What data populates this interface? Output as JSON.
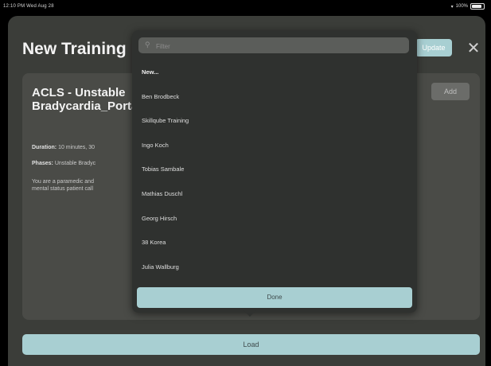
{
  "status_bar": {
    "time_date": "12:10 PM  Wed Aug 28",
    "battery": "100%",
    "battery_level": 1.0
  },
  "modal": {
    "title": "New Training",
    "update_label": "Update",
    "close_glyph": "✕"
  },
  "card": {
    "title": "ACLS - Unstable Bradycardia_Portal_38K",
    "duration_label": "Duration:",
    "duration_value": "10 minutes, 30",
    "phases_label": "Phases:",
    "phases_value": "Unstable Bradyc",
    "desc_line1": "You are a paramedic and",
    "desc_line2": "mental status patient call",
    "add_label": "Add"
  },
  "popover": {
    "filter_placeholder": "Filter",
    "search_icon": "search-icon",
    "items": [
      {
        "label": "New..."
      },
      {
        "label": "Ben Brodbeck"
      },
      {
        "label": "Skillqube Training"
      },
      {
        "label": "Ingo Koch"
      },
      {
        "label": "Tobias Sambale"
      },
      {
        "label": "Mathias Duschl"
      },
      {
        "label": "Georg Hirsch"
      },
      {
        "label": "38 Korea"
      },
      {
        "label": "Julia Wallburg"
      }
    ],
    "done_label": "Done"
  },
  "footer": {
    "load_label": "Load"
  },
  "colors": {
    "accent": "#a8cfd2",
    "modal_bg": "#3b3d39",
    "card_bg": "#4a4b47",
    "popover_bg": "#2f312f"
  }
}
